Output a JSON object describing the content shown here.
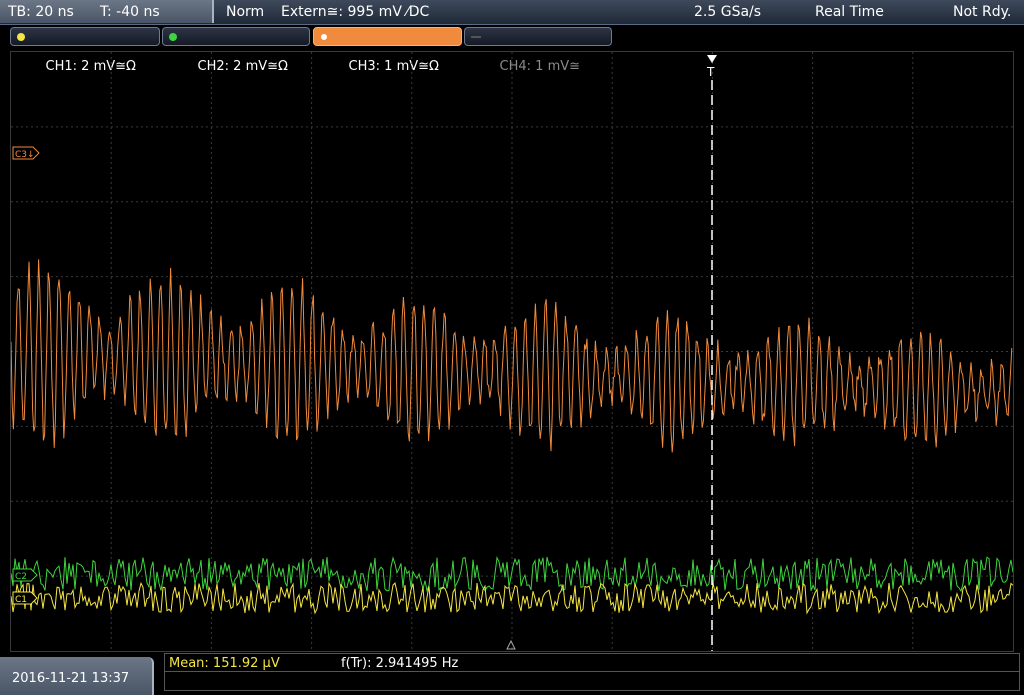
{
  "topbar": {
    "timebase": "TB: 20 ns",
    "trigger_time": "T: -40 ns",
    "mode": "Norm",
    "trigger_source": "Extern≅: 995 mV ⁄DC",
    "sample_rate": "2.5 GSa/s",
    "acq_mode": "Real Time",
    "status": "Not Rdy."
  },
  "channels": [
    {
      "label": "CH1: 2 mV≅Ω",
      "color": "#f5e642",
      "active": false,
      "enabled": true
    },
    {
      "label": "CH2: 2 mV≅Ω",
      "color": "#3ed43e",
      "active": false,
      "enabled": true
    },
    {
      "label": "CH3: 1 mV≅Ω",
      "color": "#f08a3c",
      "active": true,
      "enabled": true
    },
    {
      "label": "CH4: 1 mV≅",
      "color": "#777777",
      "active": false,
      "enabled": false
    }
  ],
  "markers": {
    "c3": "C3↓",
    "c2": "C2",
    "c1": "C1",
    "trigger": "T"
  },
  "colors": {
    "ch1": "#f5e642",
    "ch2": "#3ed43e",
    "ch3": "#f08a3c",
    "grid": "#3a3a3a"
  },
  "footer": {
    "datetime": "2016-11-21 13:37",
    "meas1": "Mean: 151.92 µV",
    "meas2": "f(Tr): 2.941495 Hz"
  }
}
